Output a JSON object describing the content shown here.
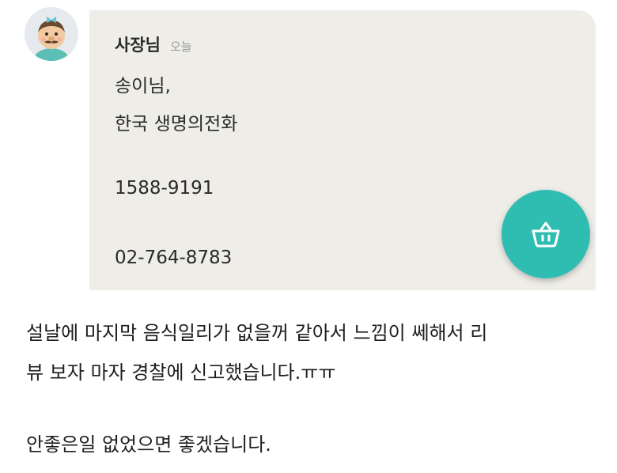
{
  "message": {
    "sender": "사장님",
    "time": "오늘",
    "lines": [
      "송이님,",
      "한국 생명의전화",
      "1588-9191",
      "02-764-8783"
    ]
  },
  "fab": {
    "icon": "basket-icon",
    "color": "#2fbdb2"
  },
  "caption": {
    "lines": [
      "설날에 마지막 음식일리가 없을꺼 같아서 느낌이 쎄해서 리",
      "뷰 보자 마자 경찰에 신고했습니다.ㅠㅠ",
      "안좋은일 없었으면 좋겠습니다."
    ]
  }
}
